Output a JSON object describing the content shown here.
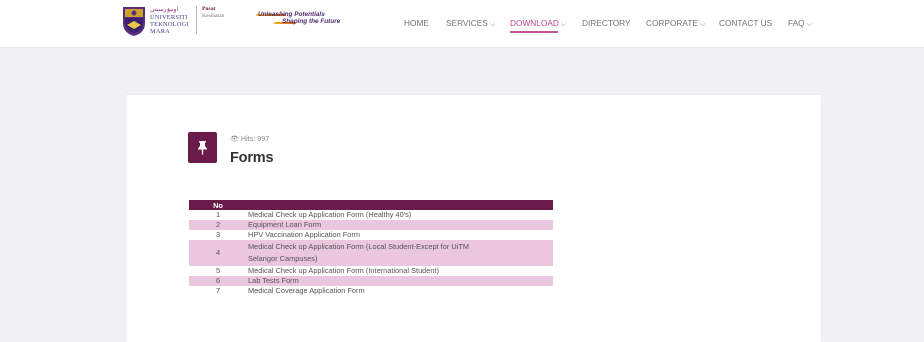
{
  "header": {
    "university": {
      "jawi": "اونيۏرسيتي",
      "line1": "UNIVERSITI",
      "line2": "TEKNOLOGI",
      "line3": "MARA"
    },
    "department": {
      "line1": "Pusat",
      "line2": "Kesihatan"
    },
    "tagline": {
      "line1": "Unleashing Potentials",
      "line2": "Shaping the Future"
    },
    "nav": [
      {
        "label": "HOME",
        "has_dropdown": false,
        "active": false
      },
      {
        "label": "SERVICES",
        "has_dropdown": true,
        "active": false
      },
      {
        "label": "DOWNLOAD",
        "has_dropdown": true,
        "active": true
      },
      {
        "label": "DIRECTORY",
        "has_dropdown": false,
        "active": false
      },
      {
        "label": "CORPORATE",
        "has_dropdown": true,
        "active": false
      },
      {
        "label": "CONTACT US",
        "has_dropdown": false,
        "active": false
      },
      {
        "label": "FAQ",
        "has_dropdown": true,
        "active": false
      }
    ],
    "chevron": "⌵"
  },
  "article": {
    "icon": "pushpin-icon",
    "hits_label": "Hits: 997",
    "title": "Forms"
  },
  "table": {
    "headers": [
      "No",
      ""
    ],
    "rows": [
      {
        "no": "1",
        "name": "Medical Check up Application Form (Healthy 40's)"
      },
      {
        "no": "2",
        "name": "Equipment Loan Form"
      },
      {
        "no": "3",
        "name": "HPV Vaccination Application Form"
      },
      {
        "no": "4",
        "name": "Medical Check up Application Form (Local Student-Except for UiTM Selangor Campuses)"
      },
      {
        "no": "5",
        "name": "Medical Check up Application Form (International Student)"
      },
      {
        "no": "6",
        "name": "Lab Tests Form"
      },
      {
        "no": "7",
        "name": "Medical Coverage Application Form"
      }
    ]
  },
  "colors": {
    "brand_purple": "#6b1b4a",
    "row_pink": "#ebc6df",
    "nav_active": "#b8458f"
  }
}
